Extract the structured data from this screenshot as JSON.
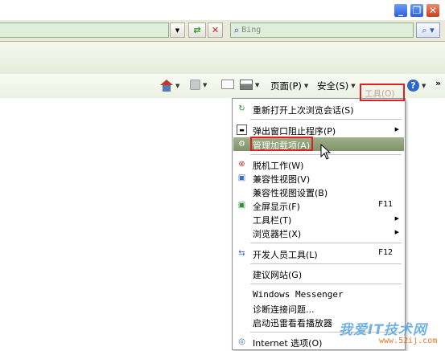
{
  "search": {
    "placeholder": "Bing"
  },
  "commandbar": {
    "page_label": "页面(P)",
    "safety_label": "安全(S)",
    "tools_label": "工具(O)",
    "more": "»"
  },
  "menu": {
    "items": [
      {
        "label": "重新打开上次浏览会话(S)",
        "icon": "reopen-session-icon"
      },
      {
        "label": "弹出窗口阻止程序(P)",
        "submenu": true,
        "icon": "popup-blocker-icon"
      },
      {
        "label": "管理加载项(A)",
        "highlighted": true,
        "icon": "manage-addons-icon"
      },
      {
        "label": "脱机工作(W)",
        "icon": "work-offline-icon"
      },
      {
        "label": "兼容性视图(V)",
        "icon": "compat-view-icon"
      },
      {
        "label": "兼容性视图设置(B)"
      },
      {
        "label": "全屏显示(F)",
        "accel": "F11",
        "icon": "fullscreen-icon"
      },
      {
        "label": "工具栏(T)",
        "submenu": true
      },
      {
        "label": "浏览器栏(X)",
        "submenu": true
      },
      {
        "label": "开发人员工具(L)",
        "accel": "F12",
        "icon": "developer-tools-icon"
      },
      {
        "label": "建议网站(G)"
      },
      {
        "label": "Windows Messenger"
      },
      {
        "label": "诊断连接问题..."
      },
      {
        "label": "启动迅雷看看播放器"
      },
      {
        "label": "Internet 选项(O)",
        "icon": "internet-options-icon"
      }
    ]
  },
  "watermark": {
    "brand": "我爱IT技术网",
    "url": "www.52ij.com"
  },
  "colors": {
    "highlight": "#8a9d74",
    "annotation_red": "#e02020",
    "toolbar_green": "#dfeedb"
  }
}
